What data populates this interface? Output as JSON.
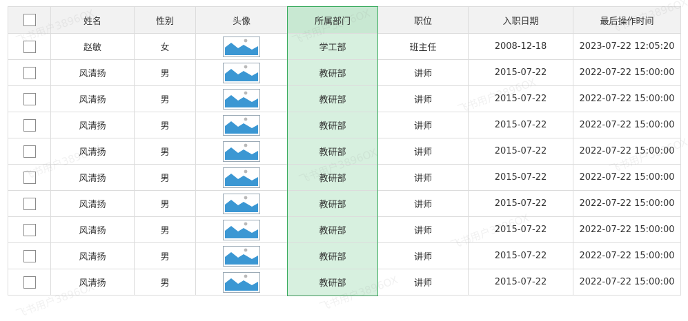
{
  "columns": [
    "姓名",
    "性别",
    "头像",
    "所属部门",
    "职位",
    "入职日期",
    "最后操作时间"
  ],
  "rows": [
    {
      "name": "赵敏",
      "gender": "女",
      "dept": "学工部",
      "position": "班主任",
      "entry": "2008-12-18",
      "updated": "2023-07-22 12:05:20"
    },
    {
      "name": "风清扬",
      "gender": "男",
      "dept": "教研部",
      "position": "讲师",
      "entry": "2015-07-22",
      "updated": "2022-07-22 15:00:00"
    },
    {
      "name": "风清扬",
      "gender": "男",
      "dept": "教研部",
      "position": "讲师",
      "entry": "2015-07-22",
      "updated": "2022-07-22 15:00:00"
    },
    {
      "name": "风清扬",
      "gender": "男",
      "dept": "教研部",
      "position": "讲师",
      "entry": "2015-07-22",
      "updated": "2022-07-22 15:00:00"
    },
    {
      "name": "风清扬",
      "gender": "男",
      "dept": "教研部",
      "position": "讲师",
      "entry": "2015-07-22",
      "updated": "2022-07-22 15:00:00"
    },
    {
      "name": "风清扬",
      "gender": "男",
      "dept": "教研部",
      "position": "讲师",
      "entry": "2015-07-22",
      "updated": "2022-07-22 15:00:00"
    },
    {
      "name": "风清扬",
      "gender": "男",
      "dept": "教研部",
      "position": "讲师",
      "entry": "2015-07-22",
      "updated": "2022-07-22 15:00:00"
    },
    {
      "name": "风清扬",
      "gender": "男",
      "dept": "教研部",
      "position": "讲师",
      "entry": "2015-07-22",
      "updated": "2022-07-22 15:00:00"
    },
    {
      "name": "风清扬",
      "gender": "男",
      "dept": "教研部",
      "position": "讲师",
      "entry": "2015-07-22",
      "updated": "2022-07-22 15:00:00"
    },
    {
      "name": "风清扬",
      "gender": "男",
      "dept": "教研部",
      "position": "讲师",
      "entry": "2015-07-22",
      "updated": "2022-07-22 15:00:00"
    }
  ],
  "avatar_icon": "image-placeholder-icon",
  "watermark": "飞书用户3896OX",
  "colors": {
    "header_bg": "#f2f2f2",
    "selected_column_bg": "#d7f0df",
    "selected_column_border": "#3aab5e",
    "image_icon": "#3b97d3"
  }
}
